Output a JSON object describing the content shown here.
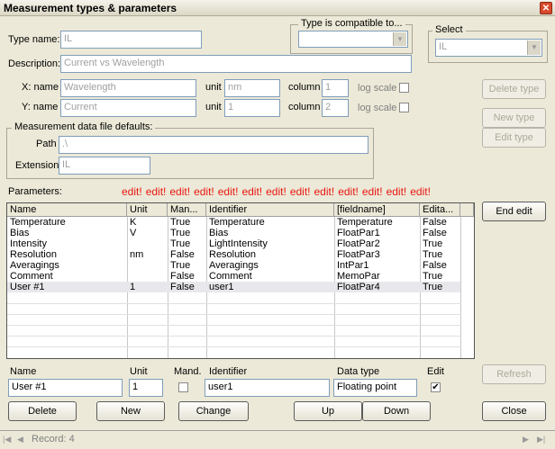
{
  "window": {
    "title": "Measurement types & parameters",
    "close_glyph": "✕"
  },
  "type_name": {
    "label": "Type name:",
    "value": "IL"
  },
  "description": {
    "label": "Description:",
    "value": "Current vs Wavelength"
  },
  "compatible": {
    "legend": "Type is compatible to...",
    "value": ""
  },
  "select": {
    "legend": "Select",
    "value": "IL"
  },
  "x_axis": {
    "label": "X: name",
    "name": "Wavelength",
    "unit_label": "unit",
    "unit": "nm",
    "column_label": "column",
    "column": "1",
    "log_label": "log scale"
  },
  "y_axis": {
    "label": "Y: name",
    "name": "Current",
    "unit_label": "unit",
    "unit": "1",
    "column_label": "column",
    "column": "2",
    "log_label": "log scale"
  },
  "file_defaults": {
    "legend": "Measurement data file defaults:",
    "path_label": "Path",
    "path": ".\\",
    "ext_label": "Extension",
    "ext": "IL"
  },
  "buttons": {
    "delete_type": "Delete type",
    "new_type": "New type",
    "edit_type": "Edit type",
    "end_edit": "End edit",
    "refresh": "Refresh",
    "delete": "Delete",
    "new": "New",
    "change": "Change",
    "up": "Up",
    "down": "Down",
    "close": "Close"
  },
  "parameters_label": "Parameters:",
  "edit_marks": [
    "edit!",
    "edit!",
    "edit!",
    "edit!",
    "edit!",
    "edit!",
    "edit!",
    "edit!",
    "edit!",
    "edit!",
    "edit!",
    "edit!",
    "edit!"
  ],
  "table": {
    "columns": [
      "Name",
      "Unit",
      "Man...",
      "Identifier",
      "[fieldname]",
      "Edita..."
    ],
    "rows": [
      [
        "Temperature",
        "K",
        "True",
        "Temperature",
        "Temperature",
        "False"
      ],
      [
        "Bias",
        "V",
        "True",
        "Bias",
        "FloatPar1",
        "False"
      ],
      [
        "Intensity",
        "",
        "True",
        "LightIntensity",
        "FloatPar2",
        "True"
      ],
      [
        "Resolution",
        "nm",
        "False",
        "Resolution",
        "FloatPar3",
        "True"
      ],
      [
        "Averagings",
        "",
        "True",
        "Averagings",
        "IntPar1",
        "False"
      ],
      [
        "Comment",
        "",
        "False",
        "Comment",
        "MemoPar",
        "True"
      ],
      [
        "User #1",
        "1",
        "False",
        "user1",
        "FloatPar4",
        "True"
      ]
    ]
  },
  "editor": {
    "name_label": "Name",
    "name": "User #1",
    "unit_label": "Unit",
    "unit": "1",
    "mand_label": "Mand.",
    "identifier_label": "Identifier",
    "identifier": "user1",
    "datatype_label": "Data type",
    "datatype": "Floating point",
    "edit_label": "Edit",
    "edit_check": "✔"
  },
  "status": {
    "record": "Record: 4"
  }
}
